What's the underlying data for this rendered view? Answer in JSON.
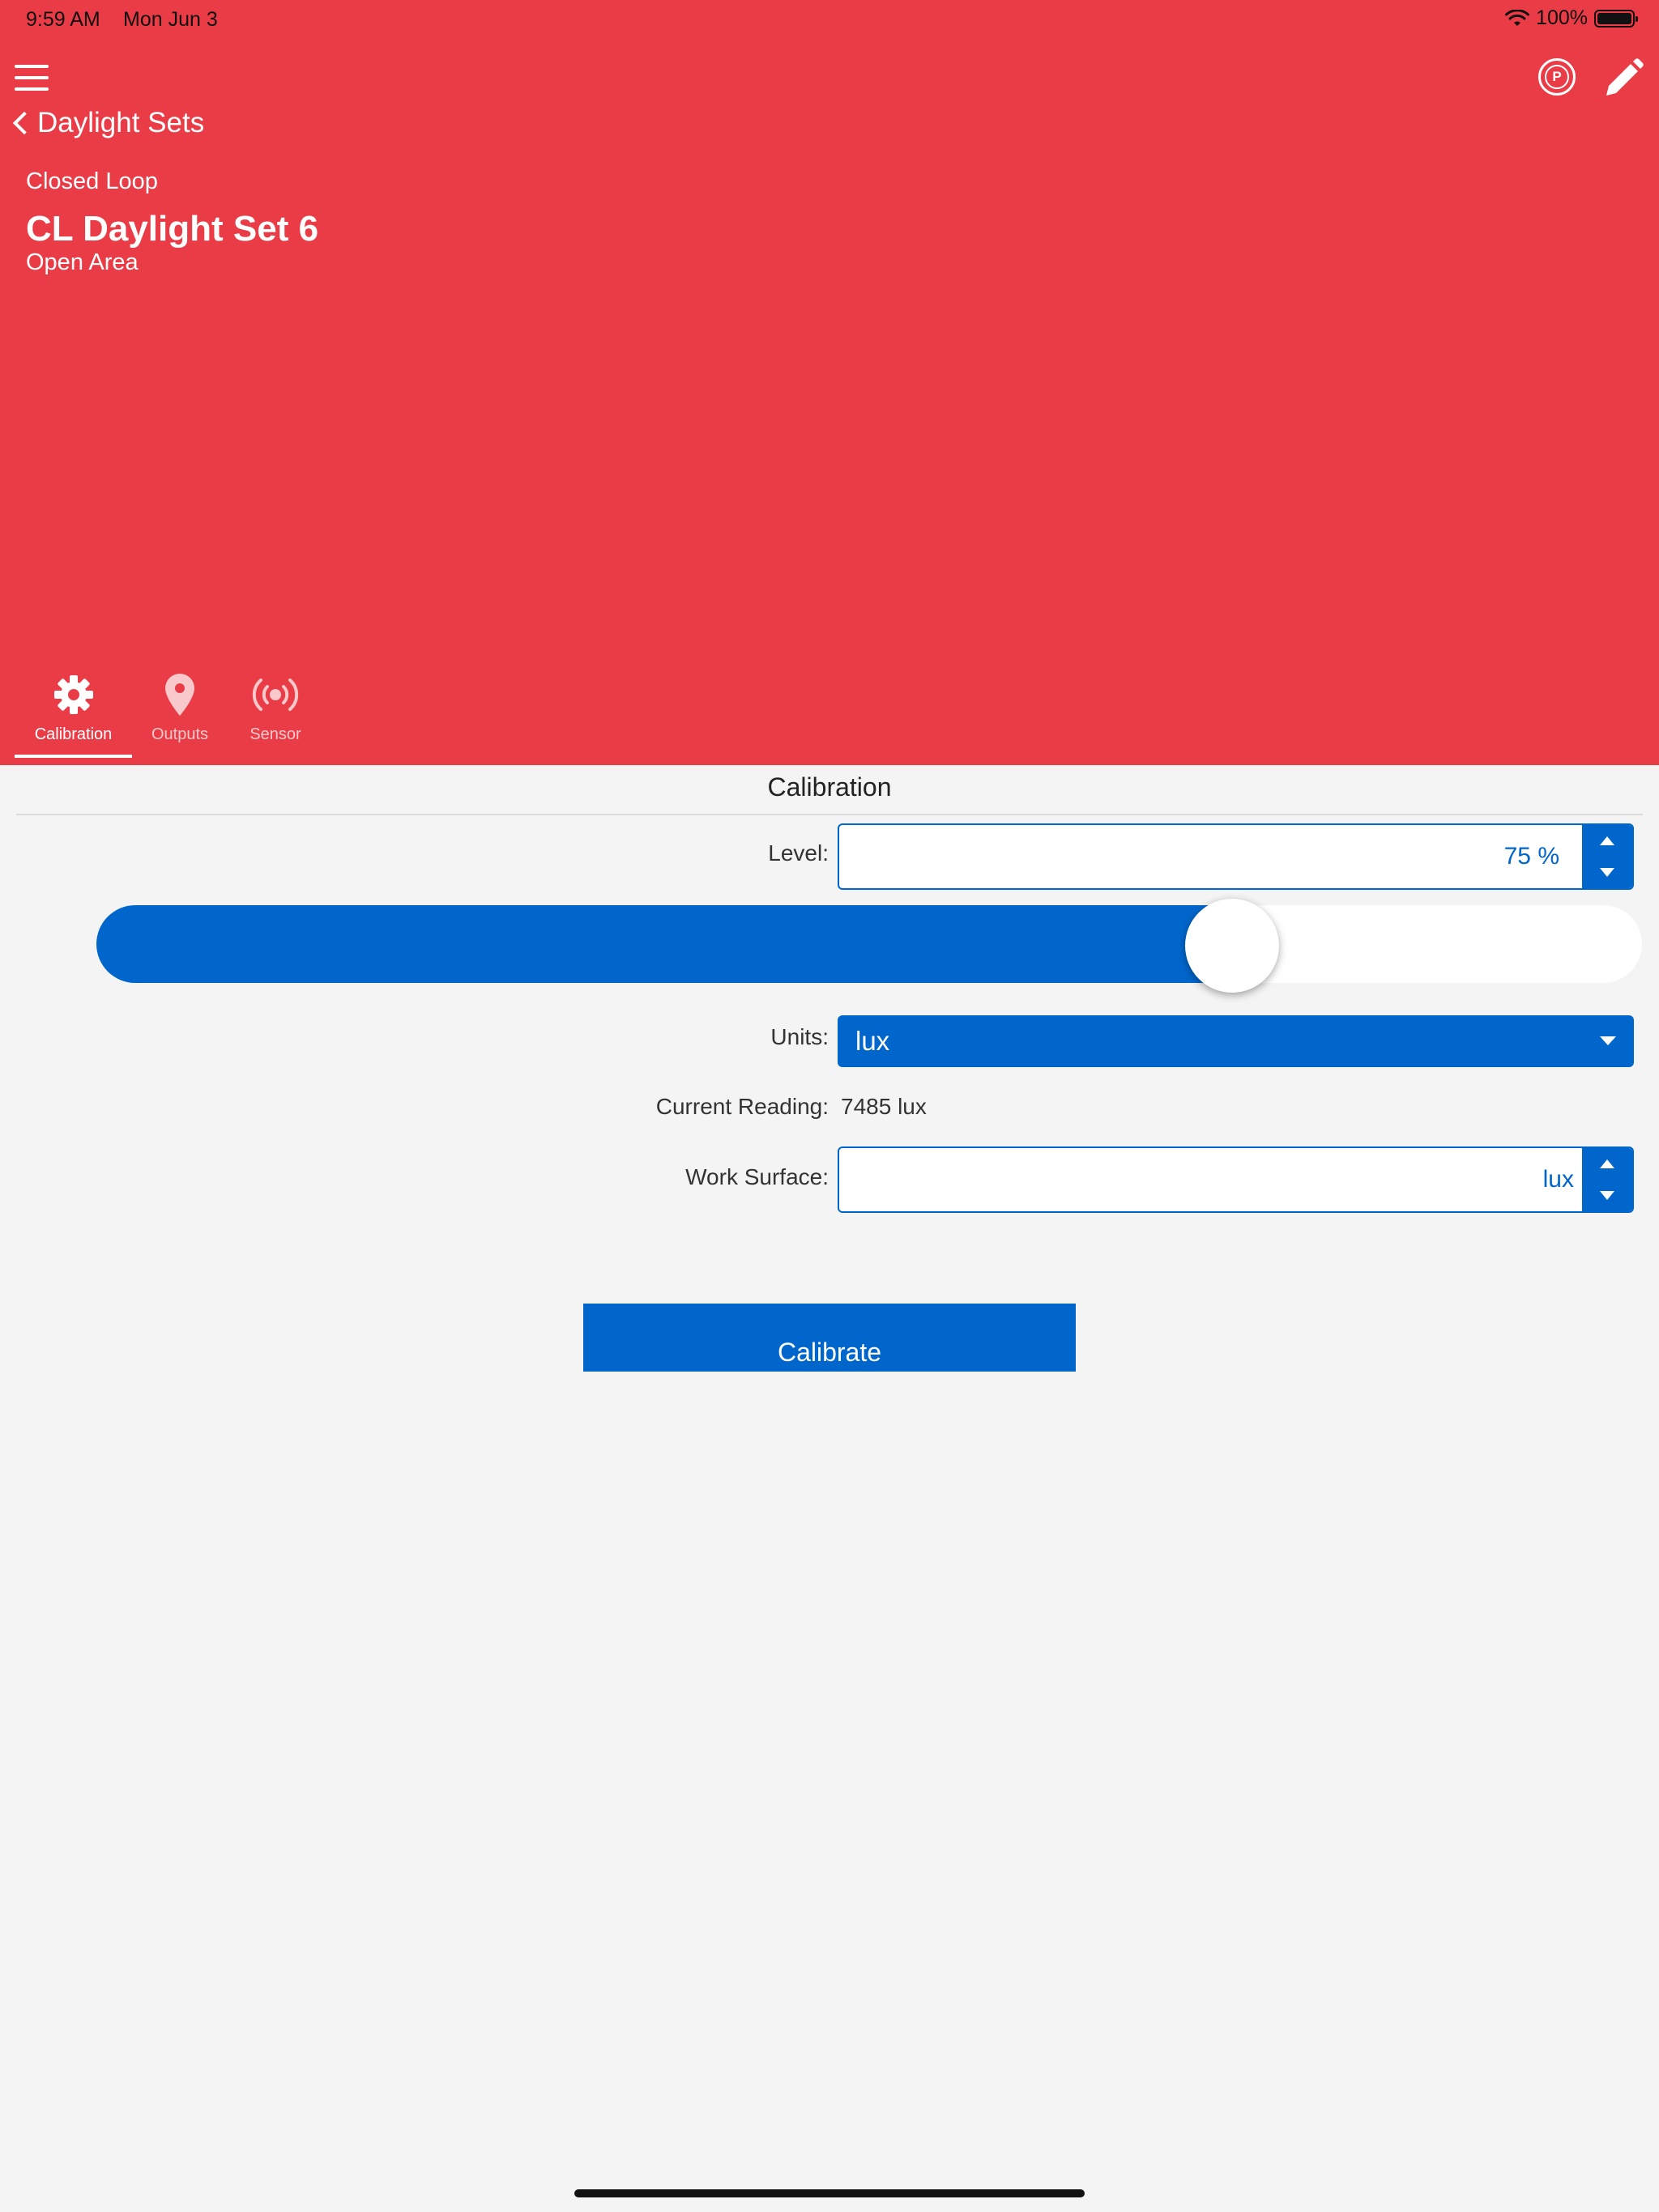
{
  "status_bar": {
    "time": "9:59 AM",
    "date": "Mon Jun 3",
    "battery": "100%"
  },
  "header": {
    "back_label": "Daylight Sets",
    "p_badge": "P",
    "category": "Closed Loop",
    "title": "CL Daylight Set 6",
    "area": "Open Area"
  },
  "tabs": [
    {
      "label": "Calibration",
      "icon": "gear-icon"
    },
    {
      "label": "Outputs",
      "icon": "location-pin-icon"
    },
    {
      "label": "Sensor",
      "icon": "broadcast-icon"
    }
  ],
  "section": {
    "title": "Calibration"
  },
  "form": {
    "level_label": "Level:",
    "level_value": "75 %",
    "level_percent": 75,
    "units_label": "Units:",
    "units_value": "lux",
    "reading_label": "Current Reading:",
    "reading_value": "7485 lux",
    "work_surface_label": "Work Surface:",
    "work_surface_value": "lux"
  },
  "actions": {
    "calibrate_label": "Calibrate"
  },
  "colors": {
    "header": "#e93c46",
    "accent": "#0066cc",
    "background": "#f4f4f4"
  }
}
